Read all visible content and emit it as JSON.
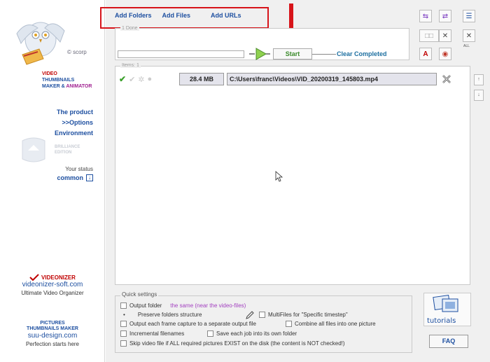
{
  "sidebar": {
    "copyright": "© scorp",
    "brand_line1": "VIDEO",
    "brand_line2": "THUMBNAILS",
    "brand_line3a": "MAKER & ",
    "brand_line3b": "ANIMATOR",
    "nav": [
      {
        "label": "The product"
      },
      {
        "label": ">>Options"
      },
      {
        "label": "Environment"
      }
    ],
    "edition_line1": "BRILLIANCE",
    "edition_line2": "EDITION",
    "status_label": "Your status",
    "status_value": "common",
    "status_icon": "download-icon",
    "videonizer": {
      "name": "VIDEONIZER",
      "site": "videonizer-soft.com",
      "desc": "Ultimate Video Organizer"
    },
    "ptm": {
      "line1": "PICTURES",
      "line2": "THUMBNAILS MAKER",
      "site": "suu-design.com",
      "desc": "Perfection starts here"
    }
  },
  "toolbar": {
    "add_folders": "Add Folders",
    "add_files": "Add Files",
    "add_urls": "Add URLs"
  },
  "job": {
    "group_label": "1 Done",
    "start_label": "Start",
    "clear_label": "Clear Completed",
    "progress": 0
  },
  "right_tools": {
    "all_label": "ALL"
  },
  "items": {
    "label": "Items: 1",
    "rows": [
      {
        "size": "28.4 MB",
        "path": "C:\\Users\\franc\\Videos\\VID_20200319_145803.mp4"
      }
    ]
  },
  "quick_settings": {
    "label": "Quick settings",
    "output_folder": "Output folder",
    "output_folder_value": "the same (near the video-files)",
    "preserve": "Preserve folders structure",
    "multifiles": "MultiFiles for \"Specific timestep\"",
    "separate": "Output each frame capture to a separate output file",
    "combine": "Combine all files into one picture",
    "incremental": "Incremental filenames",
    "save_each": "Save each job into its own folder",
    "skip": "Skip video file if ALL required pictures EXIST on the disk (the content is NOT checked!)"
  },
  "help": {
    "tutorials": "tutorials",
    "faq": "FAQ"
  },
  "colors": {
    "link_blue": "#1d4fa0",
    "start_green": "#3a8a2a",
    "highlight_red": "#d7141a",
    "purple": "#a23fbf"
  }
}
